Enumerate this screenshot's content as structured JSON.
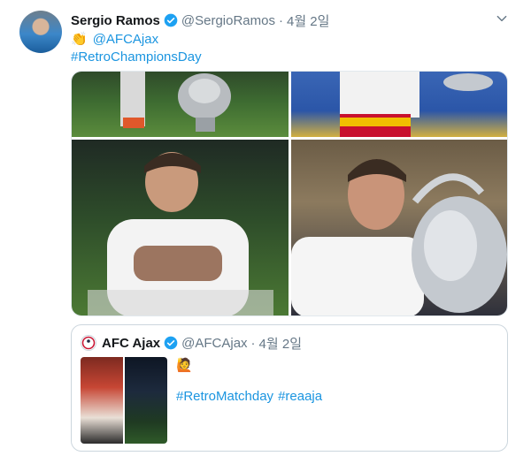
{
  "tweet": {
    "author_name": "Sergio Ramos",
    "handle": "@SergioRamos",
    "separator": "·",
    "date": "4월 2일",
    "clap_emoji": "👏",
    "mention": "@AFCAjax",
    "hashtag": "#RetroChampionsDay",
    "verified_icon": "verified-badge",
    "menu_icon": "chevron-down",
    "accent_color": "#1b95e0"
  },
  "quoted_tweet": {
    "author_name": "AFC Ajax",
    "handle": "@AFCAjax",
    "separator": "·",
    "date": "4월 2일",
    "emoji": "🙋",
    "hashtags": [
      "#RetroMatchday",
      "#reaaja"
    ]
  }
}
